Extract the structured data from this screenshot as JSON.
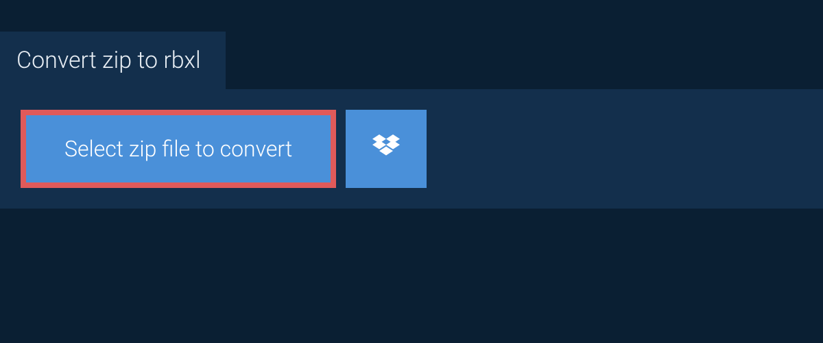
{
  "header": {
    "title": "Convert zip to rbxl"
  },
  "actions": {
    "select_file_label": "Select zip file to convert",
    "dropbox_icon": "dropbox-icon"
  },
  "colors": {
    "background": "#0a1f33",
    "panel": "#132f4c",
    "button": "#4a90d9",
    "highlight_border": "#e05a5a",
    "text_light": "#ffffff"
  }
}
